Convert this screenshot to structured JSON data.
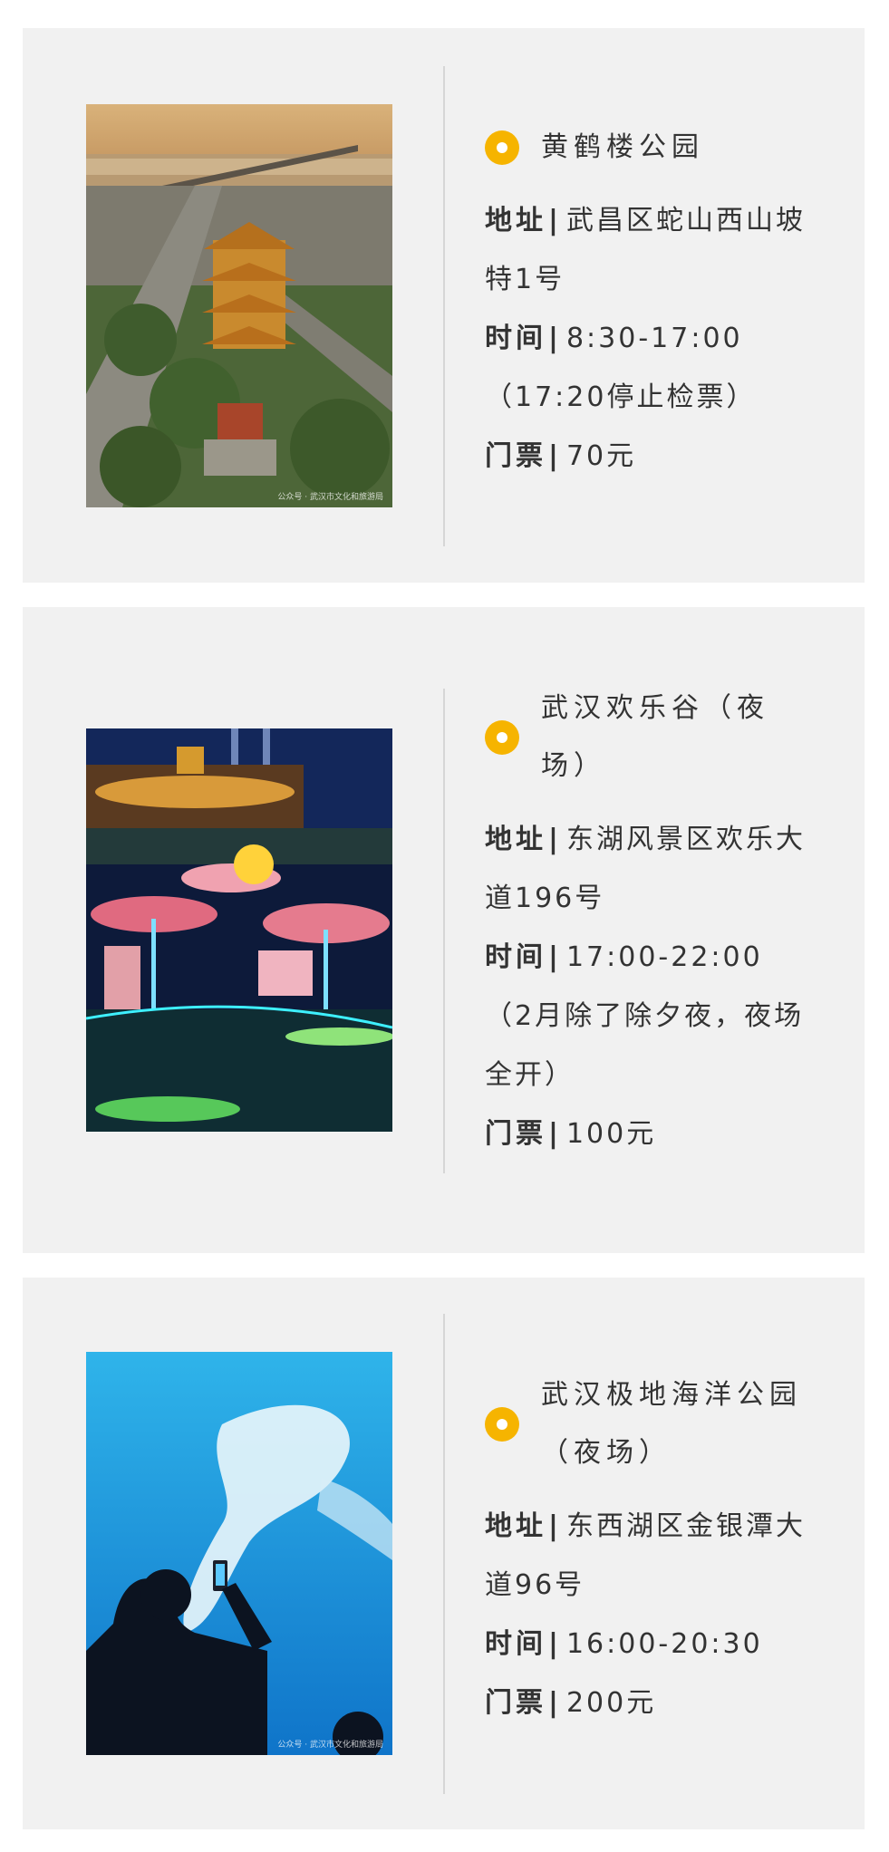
{
  "cards": [
    {
      "title": "黄鹤楼公园",
      "address_label": "地址",
      "address": "武昌区蛇山西山坡特1号",
      "time_label": "时间",
      "time": "8:30-17:00",
      "note": "（17:20停止检票）",
      "ticket_label": "门票",
      "ticket": "70元",
      "photo_watermark": "公众号 · 武汉市文化和旅游局"
    },
    {
      "title": "武汉欢乐谷（夜场）",
      "address_label": "地址",
      "address": "东湖风景区欢乐大道196号",
      "time_label": "时间",
      "time": "17:00-22:00",
      "note": "（2月除了除夕夜，夜场全开）",
      "ticket_label": "门票",
      "ticket": "100元",
      "photo_watermark": ""
    },
    {
      "title": "武汉极地海洋公园（夜场）",
      "address_label": "地址",
      "address": "东西湖区金银潭大道96号",
      "time_label": "时间",
      "time": "16:00-20:30",
      "note": "",
      "ticket_label": "门票",
      "ticket": "200元",
      "photo_watermark": "公众号 · 武汉市文化和旅游局"
    }
  ],
  "colors": {
    "accent": "#f6b400",
    "card_bg": "#f1f1f1",
    "divider": "#d6d6d6",
    "text": "#333333"
  },
  "icons": {
    "bullet": "circle-bullet-icon"
  }
}
